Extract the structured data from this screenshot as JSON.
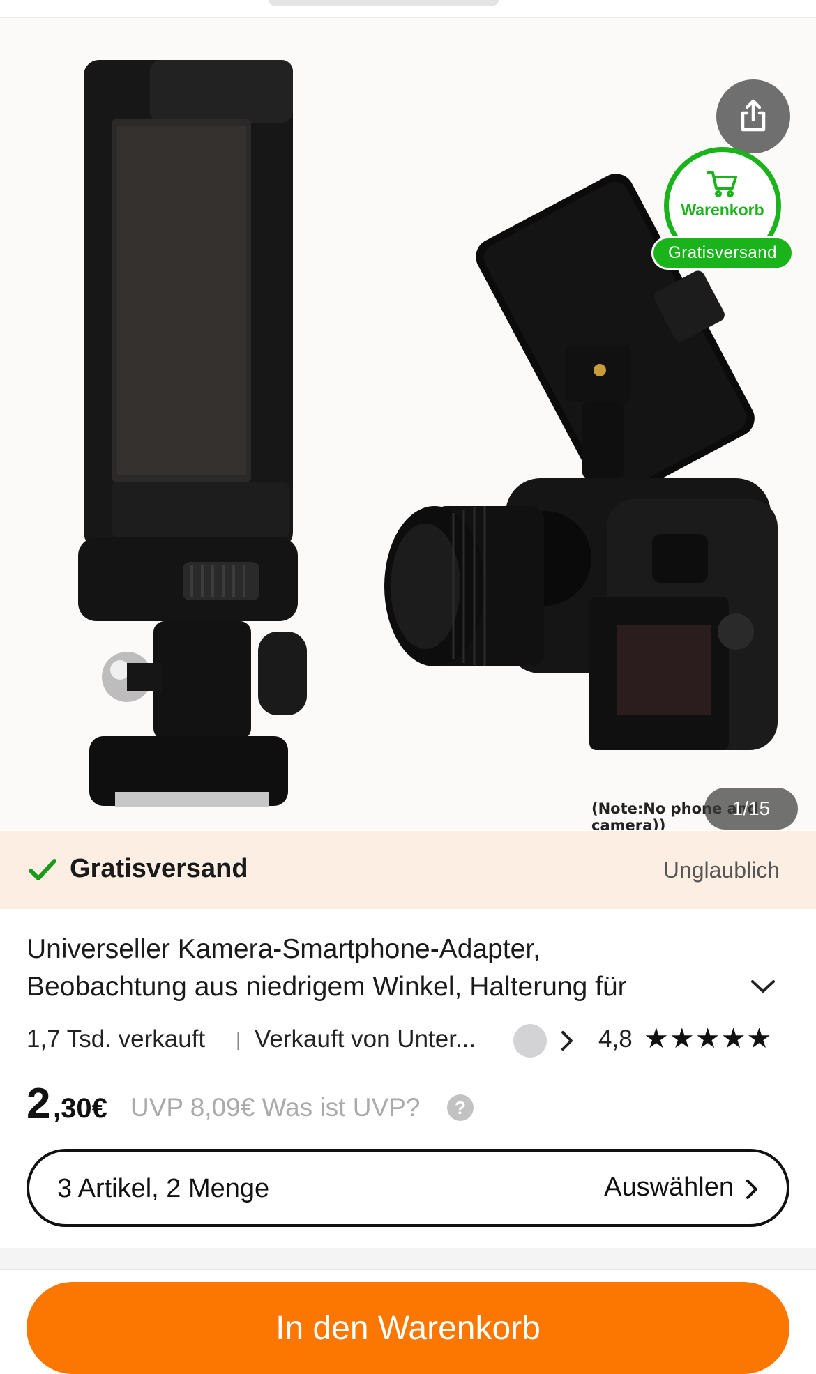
{
  "gallery": {
    "share_icon": "share-icon",
    "cart_badge_label": "Warenkorb",
    "cart_icon": "cart-icon",
    "free_shipping_pill": "Gratisversand",
    "note": "(Note:No phone and camera))",
    "image_counter": "1/15"
  },
  "promo": {
    "check_icon": "check-icon",
    "title": "Gratisversand",
    "right_label": "Unglaublich",
    "colors": {
      "background": "#fdeee3",
      "check": "#1a9a1a"
    }
  },
  "product": {
    "title_line1": "Universeller Kamera-Smartphone-Adapter,",
    "title_line2": "Beobachtung aus niedrigem Winkel, Halterung für",
    "sold": "1,7 Tsd. verkauft",
    "separator": "|",
    "seller": "Verkauft von Unter...",
    "rating": "4,8",
    "stars": "★★★★★",
    "price_int": "2",
    "price_dec": ",30€",
    "uvp": "UVP 8,09€ Was ist UVP?",
    "help": "?"
  },
  "variant": {
    "label": "3 Artikel, 2 Menge",
    "action": "Auswählen"
  },
  "cta": {
    "label": "In den Warenkorb",
    "color": "#fb7701"
  }
}
